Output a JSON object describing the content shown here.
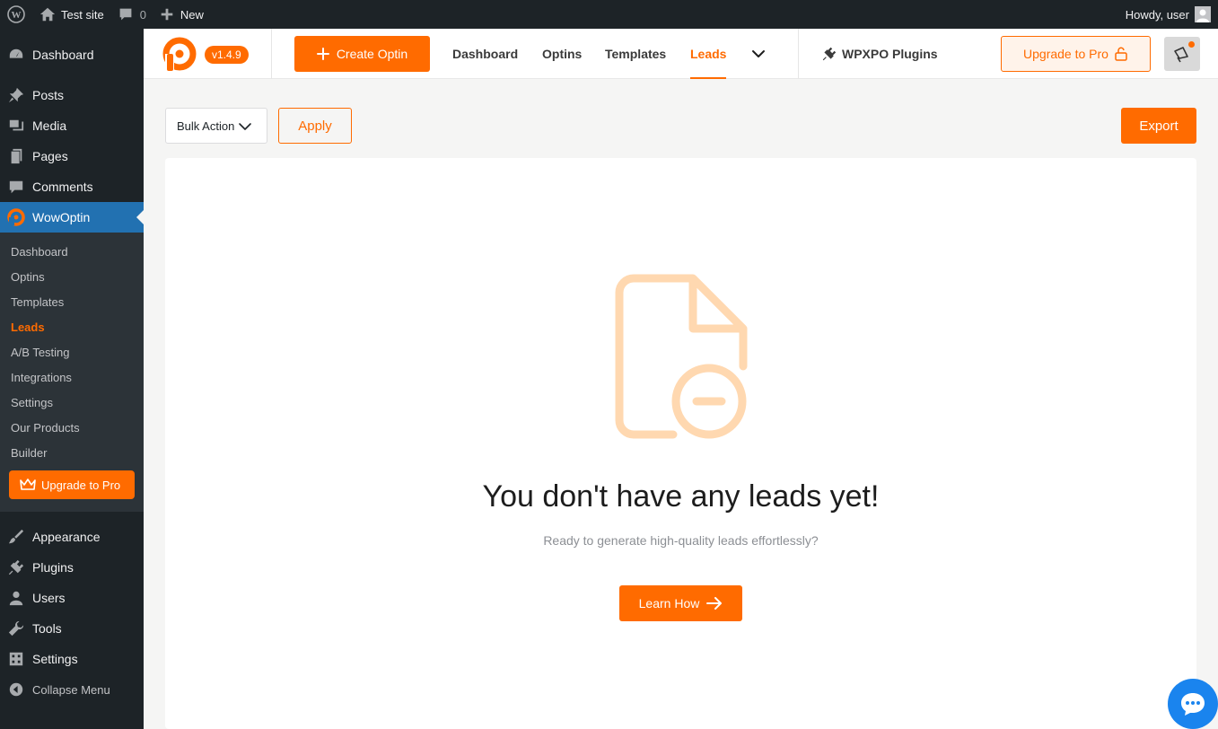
{
  "admin_bar": {
    "site_name": "Test site",
    "comments_count": "0",
    "new_label": "New",
    "howdy": "Howdy, user"
  },
  "sidebar": {
    "items_top": [
      {
        "label": "Dashboard",
        "icon": "dashboard-icon"
      },
      {
        "label": "Posts",
        "icon": "pin-icon"
      },
      {
        "label": "Media",
        "icon": "media-icon"
      },
      {
        "label": "Pages",
        "icon": "pages-icon"
      },
      {
        "label": "Comments",
        "icon": "comment-icon"
      },
      {
        "label": "WowOptin",
        "icon": "wowoptin-icon"
      }
    ],
    "submenu": [
      "Dashboard",
      "Optins",
      "Templates",
      "Leads",
      "A/B Testing",
      "Integrations",
      "Settings",
      "Our Products",
      "Builder"
    ],
    "submenu_current": "Leads",
    "upgrade_label": "Upgrade to Pro",
    "items_bottom": [
      {
        "label": "Appearance",
        "icon": "brush-icon"
      },
      {
        "label": "Plugins",
        "icon": "plugin-icon"
      },
      {
        "label": "Users",
        "icon": "users-icon"
      },
      {
        "label": "Tools",
        "icon": "wrench-icon"
      },
      {
        "label": "Settings",
        "icon": "settings-icon"
      }
    ],
    "collapse_label": "Collapse Menu"
  },
  "header": {
    "version": "v1.4.9",
    "create_label": "Create Optin",
    "nav": [
      "Dashboard",
      "Optins",
      "Templates",
      "Leads"
    ],
    "active_nav": "Leads",
    "wpxpo_label": "WPXPO Plugins",
    "upgrade_label": "Upgrade to Pro"
  },
  "toolbar": {
    "bulk_action": "Bulk Action",
    "apply_label": "Apply",
    "export_label": "Export"
  },
  "empty_state": {
    "title": "You don't have any leads yet!",
    "subtitle": "Ready to generate high-quality leads effortlessly?",
    "button_label": "Learn How"
  },
  "colors": {
    "accent": "#ff6b00",
    "admin_dark": "#1d2327",
    "wp_blue": "#2271b1",
    "icon_tint": "#ffd8b0",
    "chat_blue": "#1a84ee"
  }
}
